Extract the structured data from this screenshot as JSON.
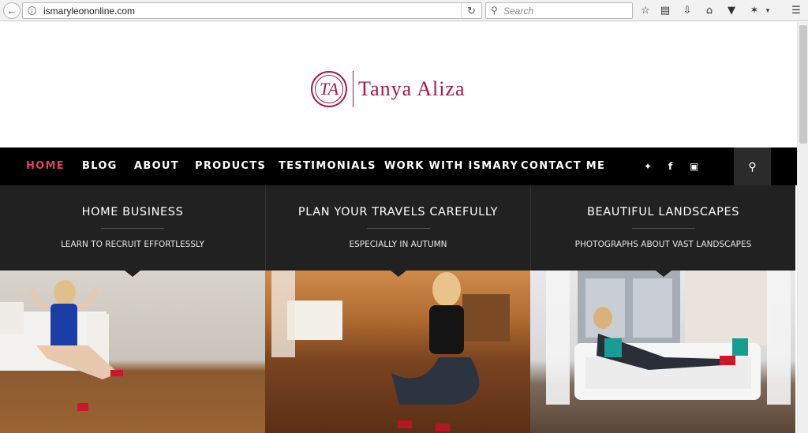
{
  "browser": {
    "url": "ismaryleononline.com",
    "search_placeholder": "Search"
  },
  "site": {
    "logo_text": "Tanya Aliza",
    "logo_monogram": "TA",
    "brand_color": "#a2184b"
  },
  "nav": {
    "items": [
      {
        "label": "HOME",
        "active": true
      },
      {
        "label": "BLOG"
      },
      {
        "label": "ABOUT"
      },
      {
        "label": "PRODUCTS"
      },
      {
        "label": "TESTIMONIALS"
      },
      {
        "label": "WORK WITH ISMARY"
      },
      {
        "label": "CONTACT ME"
      }
    ],
    "social": [
      "twitter-icon",
      "facebook-icon",
      "instagram-icon"
    ],
    "active_color": "#e23f62"
  },
  "features": [
    {
      "title": "HOME BUSINESS",
      "subtitle": "LEARN TO RECRUIT EFFORTLESSLY"
    },
    {
      "title": "PLAN YOUR TRAVELS CAREFULLY",
      "subtitle": "ESPECIALLY IN AUTUMN"
    },
    {
      "title": "BEAUTIFUL LANDSCAPES",
      "subtitle": "PHOTOGRAPHS ABOUT VAST LANDSCAPES"
    }
  ]
}
